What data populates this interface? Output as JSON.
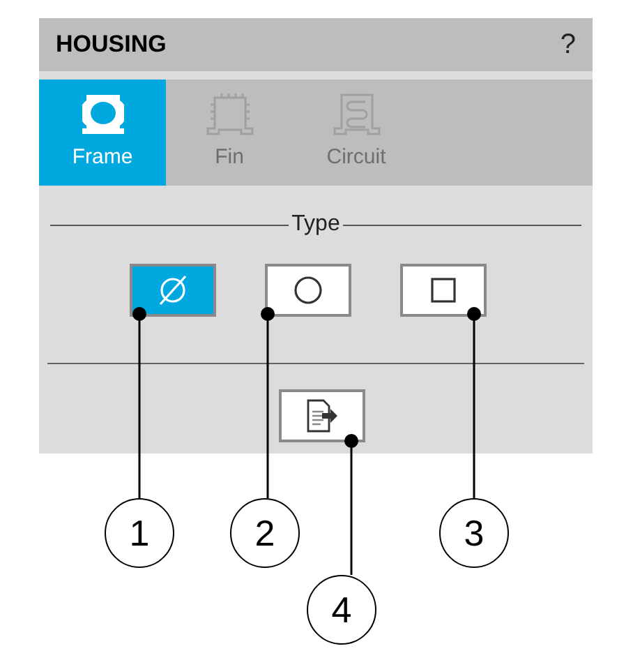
{
  "panel": {
    "title": "HOUSING",
    "help": "?"
  },
  "tabs": [
    {
      "label": "Frame",
      "kind": "frame",
      "selected": true
    },
    {
      "label": "Fin",
      "kind": "fin",
      "selected": false
    },
    {
      "label": "Circuit",
      "kind": "circuit",
      "selected": false
    }
  ],
  "type_section": {
    "legend": "Type",
    "options": [
      {
        "kind": "diameter",
        "selected": true
      },
      {
        "kind": "circle",
        "selected": false
      },
      {
        "kind": "square",
        "selected": false
      }
    ]
  },
  "callouts": [
    {
      "label": "1"
    },
    {
      "label": "2"
    },
    {
      "label": "3"
    },
    {
      "label": "4"
    }
  ]
}
